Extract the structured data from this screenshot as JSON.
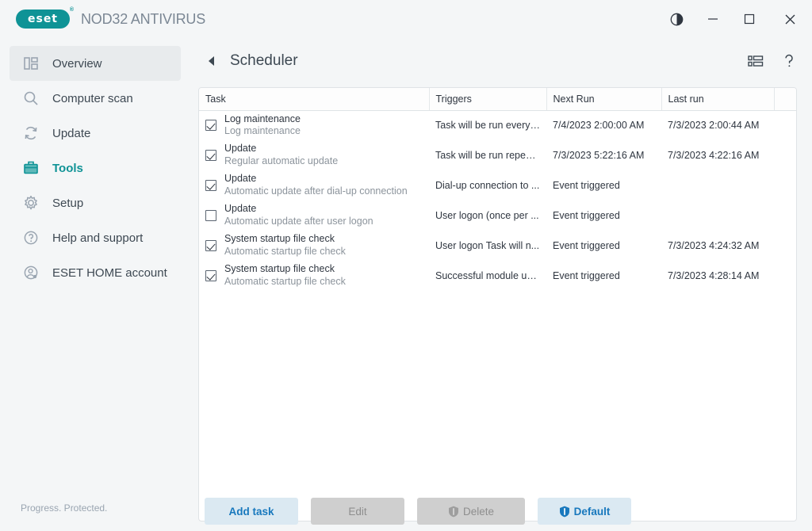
{
  "window": {
    "brand_logo_text": "eset",
    "brand_registered": "®",
    "product_name": "NOD32 ANTIVIRUS",
    "controls": [
      {
        "name": "theme-toggle",
        "icon": "contrast-icon",
        "label": ""
      },
      {
        "name": "minimize",
        "icon": "minimize-icon",
        "label": ""
      },
      {
        "name": "maximize",
        "icon": "maximize-icon",
        "label": ""
      },
      {
        "name": "close",
        "icon": "close-icon",
        "label": ""
      }
    ]
  },
  "sidebar": {
    "items": [
      {
        "label": "Overview",
        "icon": "dashboard-icon",
        "active": true,
        "current": false
      },
      {
        "label": "Computer scan",
        "icon": "search-icon",
        "active": false,
        "current": false
      },
      {
        "label": "Update",
        "icon": "refresh-icon",
        "active": false,
        "current": false
      },
      {
        "label": "Tools",
        "icon": "toolbox-icon",
        "active": false,
        "current": true
      },
      {
        "label": "Setup",
        "icon": "gear-icon",
        "active": false,
        "current": false
      },
      {
        "label": "Help and support",
        "icon": "question-icon",
        "active": false,
        "current": false
      },
      {
        "label": "ESET HOME account",
        "icon": "user-icon",
        "active": false,
        "current": false
      }
    ],
    "status": "Progress. Protected."
  },
  "header": {
    "back_label": "◀",
    "title": "Scheduler",
    "tools": [
      {
        "name": "layout-list-icon",
        "label": ""
      },
      {
        "name": "help-icon",
        "label": "?"
      }
    ]
  },
  "table": {
    "columns": [
      "Task",
      "Triggers",
      "Next Run",
      "Last run",
      ""
    ],
    "rows": [
      {
        "checked": true,
        "title": "Log maintenance",
        "subtitle": "Log maintenance",
        "trigger": "Task will be run every ...",
        "next_run": "7/4/2023 2:00:00 AM",
        "last_run": "7/3/2023 2:00:44 AM"
      },
      {
        "checked": true,
        "title": "Update",
        "subtitle": "Regular automatic update",
        "trigger": "Task will be run repeat...",
        "next_run": "7/3/2023 5:22:16 AM",
        "last_run": "7/3/2023 4:22:16 AM"
      },
      {
        "checked": true,
        "title": "Update",
        "subtitle": "Automatic update after dial-up connection",
        "trigger": "Dial-up connection to ...",
        "next_run": "Event triggered",
        "last_run": ""
      },
      {
        "checked": false,
        "title": "Update",
        "subtitle": "Automatic update after user logon",
        "trigger": "User logon (once per ...",
        "next_run": "Event triggered",
        "last_run": ""
      },
      {
        "checked": true,
        "title": "System startup file check",
        "subtitle": "Automatic startup file check",
        "trigger": "User logon Task will n...",
        "next_run": "Event triggered",
        "last_run": "7/3/2023 4:24:32 AM"
      },
      {
        "checked": true,
        "title": "System startup file check",
        "subtitle": "Automatic startup file check",
        "trigger": "Successful module up...",
        "next_run": "Event triggered",
        "last_run": "7/3/2023 4:28:14 AM"
      }
    ]
  },
  "footer": {
    "add_task": "Add task",
    "edit": "Edit",
    "delete": "Delete",
    "default": "Default"
  },
  "colors": {
    "brand_teal": "#0f9396",
    "accent_blue": "#1878bd",
    "button_light_blue": "#dbe9f2",
    "disabled_gray": "#cfcfcf",
    "app_bg": "#f4f6f7"
  }
}
